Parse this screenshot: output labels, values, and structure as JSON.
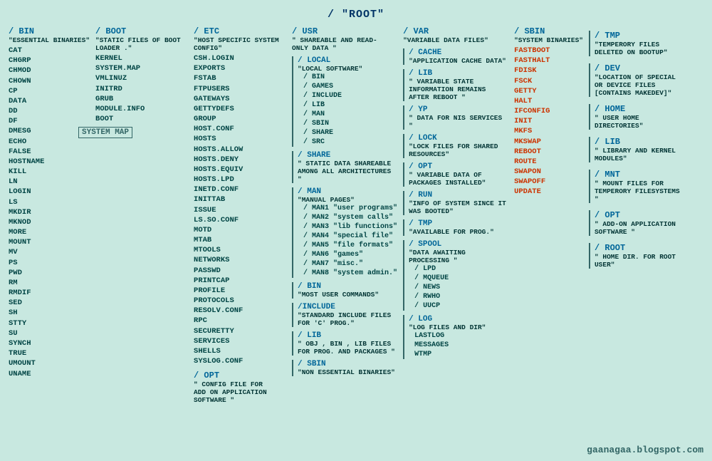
{
  "title": "/ \"ROOT\"",
  "watermark": "gaanagaa.blogspot.com",
  "system_map_label": "SYSTEM MAP",
  "columns": {
    "bin": {
      "title": "/ BIN",
      "desc": "\"ESSENTIAL BINARIES\"",
      "files": [
        "CAT",
        "CHGRP",
        "CHMOD",
        "CHOWN",
        "CP",
        "DATA",
        "DD",
        "DF",
        "DMESG",
        "ECHO",
        "FALSE",
        "HOSTNAME",
        "KILL",
        "LN",
        "LOGIN",
        "LS",
        "MKDIR",
        "MKNOD",
        "MORE",
        "MOUNT",
        "MV",
        "PS",
        "PWD",
        "RM",
        "RMDIF",
        "SED",
        "SH",
        "STTY",
        "SU",
        "SYNCH",
        "TRUE",
        "UMOUNT",
        "UNAME"
      ]
    },
    "etc": {
      "title": "/ ETC",
      "desc": "\"HOST SPECIFIC SYSTEM CONFIG\"",
      "files": [
        "CSH.LOGIN",
        "EXPORTS",
        "FSTAB",
        "FTPUSERS",
        "GATEWAYS",
        "GETTYDEFS",
        "GROUP",
        "HOST.CONF",
        "HOSTS",
        "HOSTS.ALLOW",
        "HOSTS.DENY",
        "HOSTS.EQUIV",
        "HOSTS.LPD",
        "INETD.CONF",
        "INITTAB",
        "ISSUE",
        "LS.SO.CONF",
        "MOTD",
        "MTAB",
        "MTOOLS",
        "NETWORKS",
        "PASSWD",
        "PRINTCAP",
        "PROFILE",
        "PROTOCOLS",
        "RESOLV.CONF",
        "RPC",
        "SECURETTY",
        "SERVICES",
        "SHELLS",
        "SYSLOG.CONF"
      ],
      "opt": {
        "title": "/ OPT",
        "desc": "\" CONFIG FILE FOR ADD ON APPLICATION SOFTWARE \""
      }
    },
    "boot": {
      "title": "/ BOOT",
      "desc": "\"STATIC FILES OF BOOT LOADER .\"",
      "files": [
        "KERNEL",
        "SYSTEM.MAP",
        "VMLINUZ",
        "INITRD",
        "GRUB",
        "MODULE.INFO",
        "BOOT"
      ]
    },
    "usr": {
      "title": "/ USR",
      "desc": "\" SHAREABLE AND READ-ONLY DATA \"",
      "local": {
        "title": "/ LOCAL",
        "desc": "\"LOCAL SOFTWARE\"",
        "sub": [
          "/ BIN",
          "/ GAMES",
          "/ INCLUDE",
          "/ LIB",
          "/ MAN",
          "/ SBIN",
          "/ SHARE",
          "/ SRC"
        ]
      },
      "share": {
        "title": "/ SHARE",
        "desc": "\" STATIC DATA SHAREABLE AMONG ALL ARCHITECTURES \""
      },
      "man": {
        "title": "/ MAN",
        "desc": "\"MANUAL PAGES\"",
        "sub": [
          "/ MAN1 \"user programs\"",
          "/ MAN2 \"system calls\"",
          "/ MAN3 \"lib functions\"",
          "/ MAN4 \"special file\"",
          "/ MAN5 \"file formats\"",
          "/ MAN6 \"games\"",
          "/ MAN7 \"misc.\"",
          "/ MAN8 \"system admin.\""
        ]
      },
      "bin": {
        "title": "/ BIN",
        "desc": "\"MOST USER COMMANDS\""
      },
      "include": {
        "title": "/INCLUDE",
        "desc": "\"STANDARD INCLUDE FILES FOR 'C' PROG.\""
      },
      "lib": {
        "title": "/ LIB",
        "desc": "\" OBJ , BIN , LIB FILES FOR PROG. AND PACKAGES \""
      },
      "sbin": {
        "title": "/ SBIN",
        "desc": "\"NON ESSENTIAL BINARIES\""
      }
    },
    "var": {
      "title": "/ VAR",
      "desc": "\"VARIABLE DATA FILES\"",
      "cache": {
        "title": "/ CACHE",
        "desc": "\"APPLICATION CACHE DATA\""
      },
      "lib": {
        "title": "/ LIB",
        "desc": "\" VARIABLE STATE INFORMATION REMAINS AFTER REBOOT \""
      },
      "yp": {
        "title": "/ YP",
        "desc": "\" DATA FOR NIS SERVICES \""
      },
      "lock": {
        "title": "/ LOCK",
        "desc": "\"LOCK FILES FOR SHARED RESOURCES\""
      },
      "opt": {
        "title": "/ OPT",
        "desc": "\" VARIABLE DATA OF PACKAGES INSTALLED\""
      },
      "run": {
        "title": "/ RUN",
        "desc": "\"INFO OF SYSTEM SINCE IT WAS BOOTED\""
      },
      "tmp": {
        "title": "/ TMP",
        "desc": "\"AVAILABLE FOR PROG.\""
      },
      "spool": {
        "title": "/ SPOOL",
        "desc": "\"DATA AWAITING PROCESSING \"",
        "sub": [
          "/ LPD",
          "/ MQUEUE",
          "/ NEWS",
          "/ RWHO",
          "/ UUCP"
        ]
      },
      "log": {
        "title": "/ LOG",
        "desc": "\"LOG FILES AND DIR\"",
        "files_highlight": [
          "LASTLOG",
          "MESSAGES",
          "WTMP"
        ]
      }
    },
    "sbin": {
      "title": "/ SBIN",
      "desc": "\"SYSTEM BINARIES\"",
      "files_highlight": [
        "FASTBOOT",
        "FASTHALT",
        "FDISK",
        "FSCK",
        "GETTY",
        "HALT",
        "IFCONFIG",
        "INIT",
        "MKFS",
        "MKSWAP",
        "REBOOT",
        "ROUTE",
        "SWAPON",
        "SWAPOFF",
        "UPDATE"
      ]
    },
    "right": {
      "tmp": {
        "title": "/ TMP",
        "desc": "\"TEMPERORY FILES DELETED ON BOOTUP\""
      },
      "dev": {
        "title": "/ DEV",
        "desc": "\"LOCATION OF SPECIAL OR DEVICE FILES [CONTAINS MAKEDEV]\""
      },
      "home": {
        "title": "/ HOME",
        "desc": "\" USER HOME DIRECTORIES\""
      },
      "lib": {
        "title": "/ LIB",
        "desc": "\"  LIBRARY AND KERNEL MODULES\""
      },
      "mnt": {
        "title": "/ MNT",
        "desc": "\"  MOUNT FILES FOR TEMPERORY FILESYSTEMS \""
      },
      "opt": {
        "title": "/ OPT",
        "desc": "\" ADD-ON APPLICATION SOFTWARE \""
      },
      "root": {
        "title": "/ ROOT",
        "desc": "\" HOME DIR. FOR ROOT USER\""
      }
    }
  }
}
